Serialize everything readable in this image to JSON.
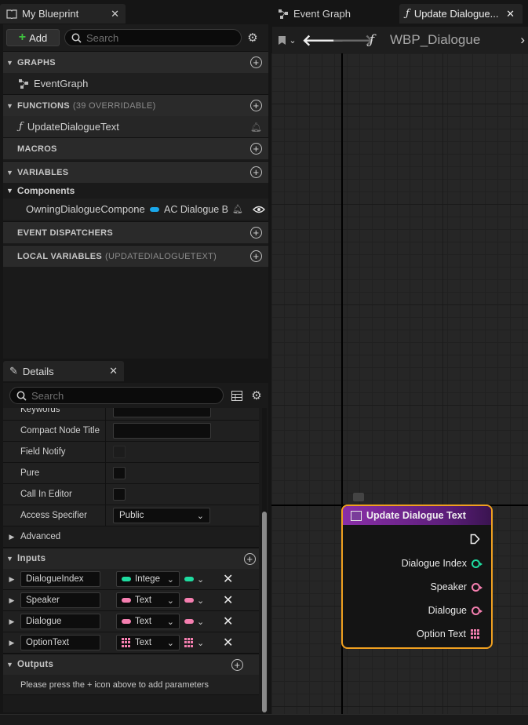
{
  "my_blueprint": {
    "tab_title": "My Blueprint",
    "add_label": "Add",
    "search_placeholder": "Search",
    "sections": {
      "graphs": "GRAPHS",
      "functions": "FUNCTIONS",
      "functions_sub": "(39 OVERRIDABLE)",
      "macros": "MACROS",
      "variables": "VARIABLES",
      "event_dispatchers": "EVENT DISPATCHERS",
      "local_variables": "LOCAL VARIABLES",
      "local_variables_sub": "(UPDATEDIALOGUETEXT)"
    },
    "graph_item": "EventGraph",
    "function_item": "UpdateDialogueText",
    "components_label": "Components",
    "variable_name": "OwningDialogueComponent",
    "variable_type": "AC Dialogue B"
  },
  "details": {
    "tab_title": "Details",
    "search_placeholder": "Search",
    "rows": {
      "keywords": "Keywords",
      "compact_node_title": "Compact Node Title",
      "field_notify": "Field Notify",
      "pure": "Pure",
      "call_in_editor": "Call In Editor",
      "access_specifier": "Access Specifier",
      "access_value": "Public",
      "advanced": "Advanced"
    },
    "inputs_label": "Inputs",
    "inputs": [
      {
        "name": "DialogueIndex",
        "type": "Intege",
        "color": "#1fdca0"
      },
      {
        "name": "Speaker",
        "type": "Text",
        "color": "#f57fb0"
      },
      {
        "name": "Dialogue",
        "type": "Text",
        "color": "#f57fb0"
      },
      {
        "name": "OptionText",
        "type": "Text",
        "color": "#f57fb0"
      }
    ],
    "outputs_label": "Outputs",
    "outputs_hint": "Please press the + icon above to add parameters"
  },
  "editor": {
    "tab_event_graph": "Event Graph",
    "tab_update": "Update Dialogue...",
    "breadcrumb": "WBP_Dialogue"
  },
  "node": {
    "title": "Update Dialogue Text",
    "pins": [
      "Dialogue Index",
      "Speaker",
      "Dialogue",
      "Option Text"
    ]
  },
  "colors": {
    "node_border": "#f0a020",
    "int_pin": "#1fdca0",
    "text_pin": "#f57fb0",
    "add_plus": "#3fc13f",
    "variable_pill": "#1aa7ea"
  }
}
